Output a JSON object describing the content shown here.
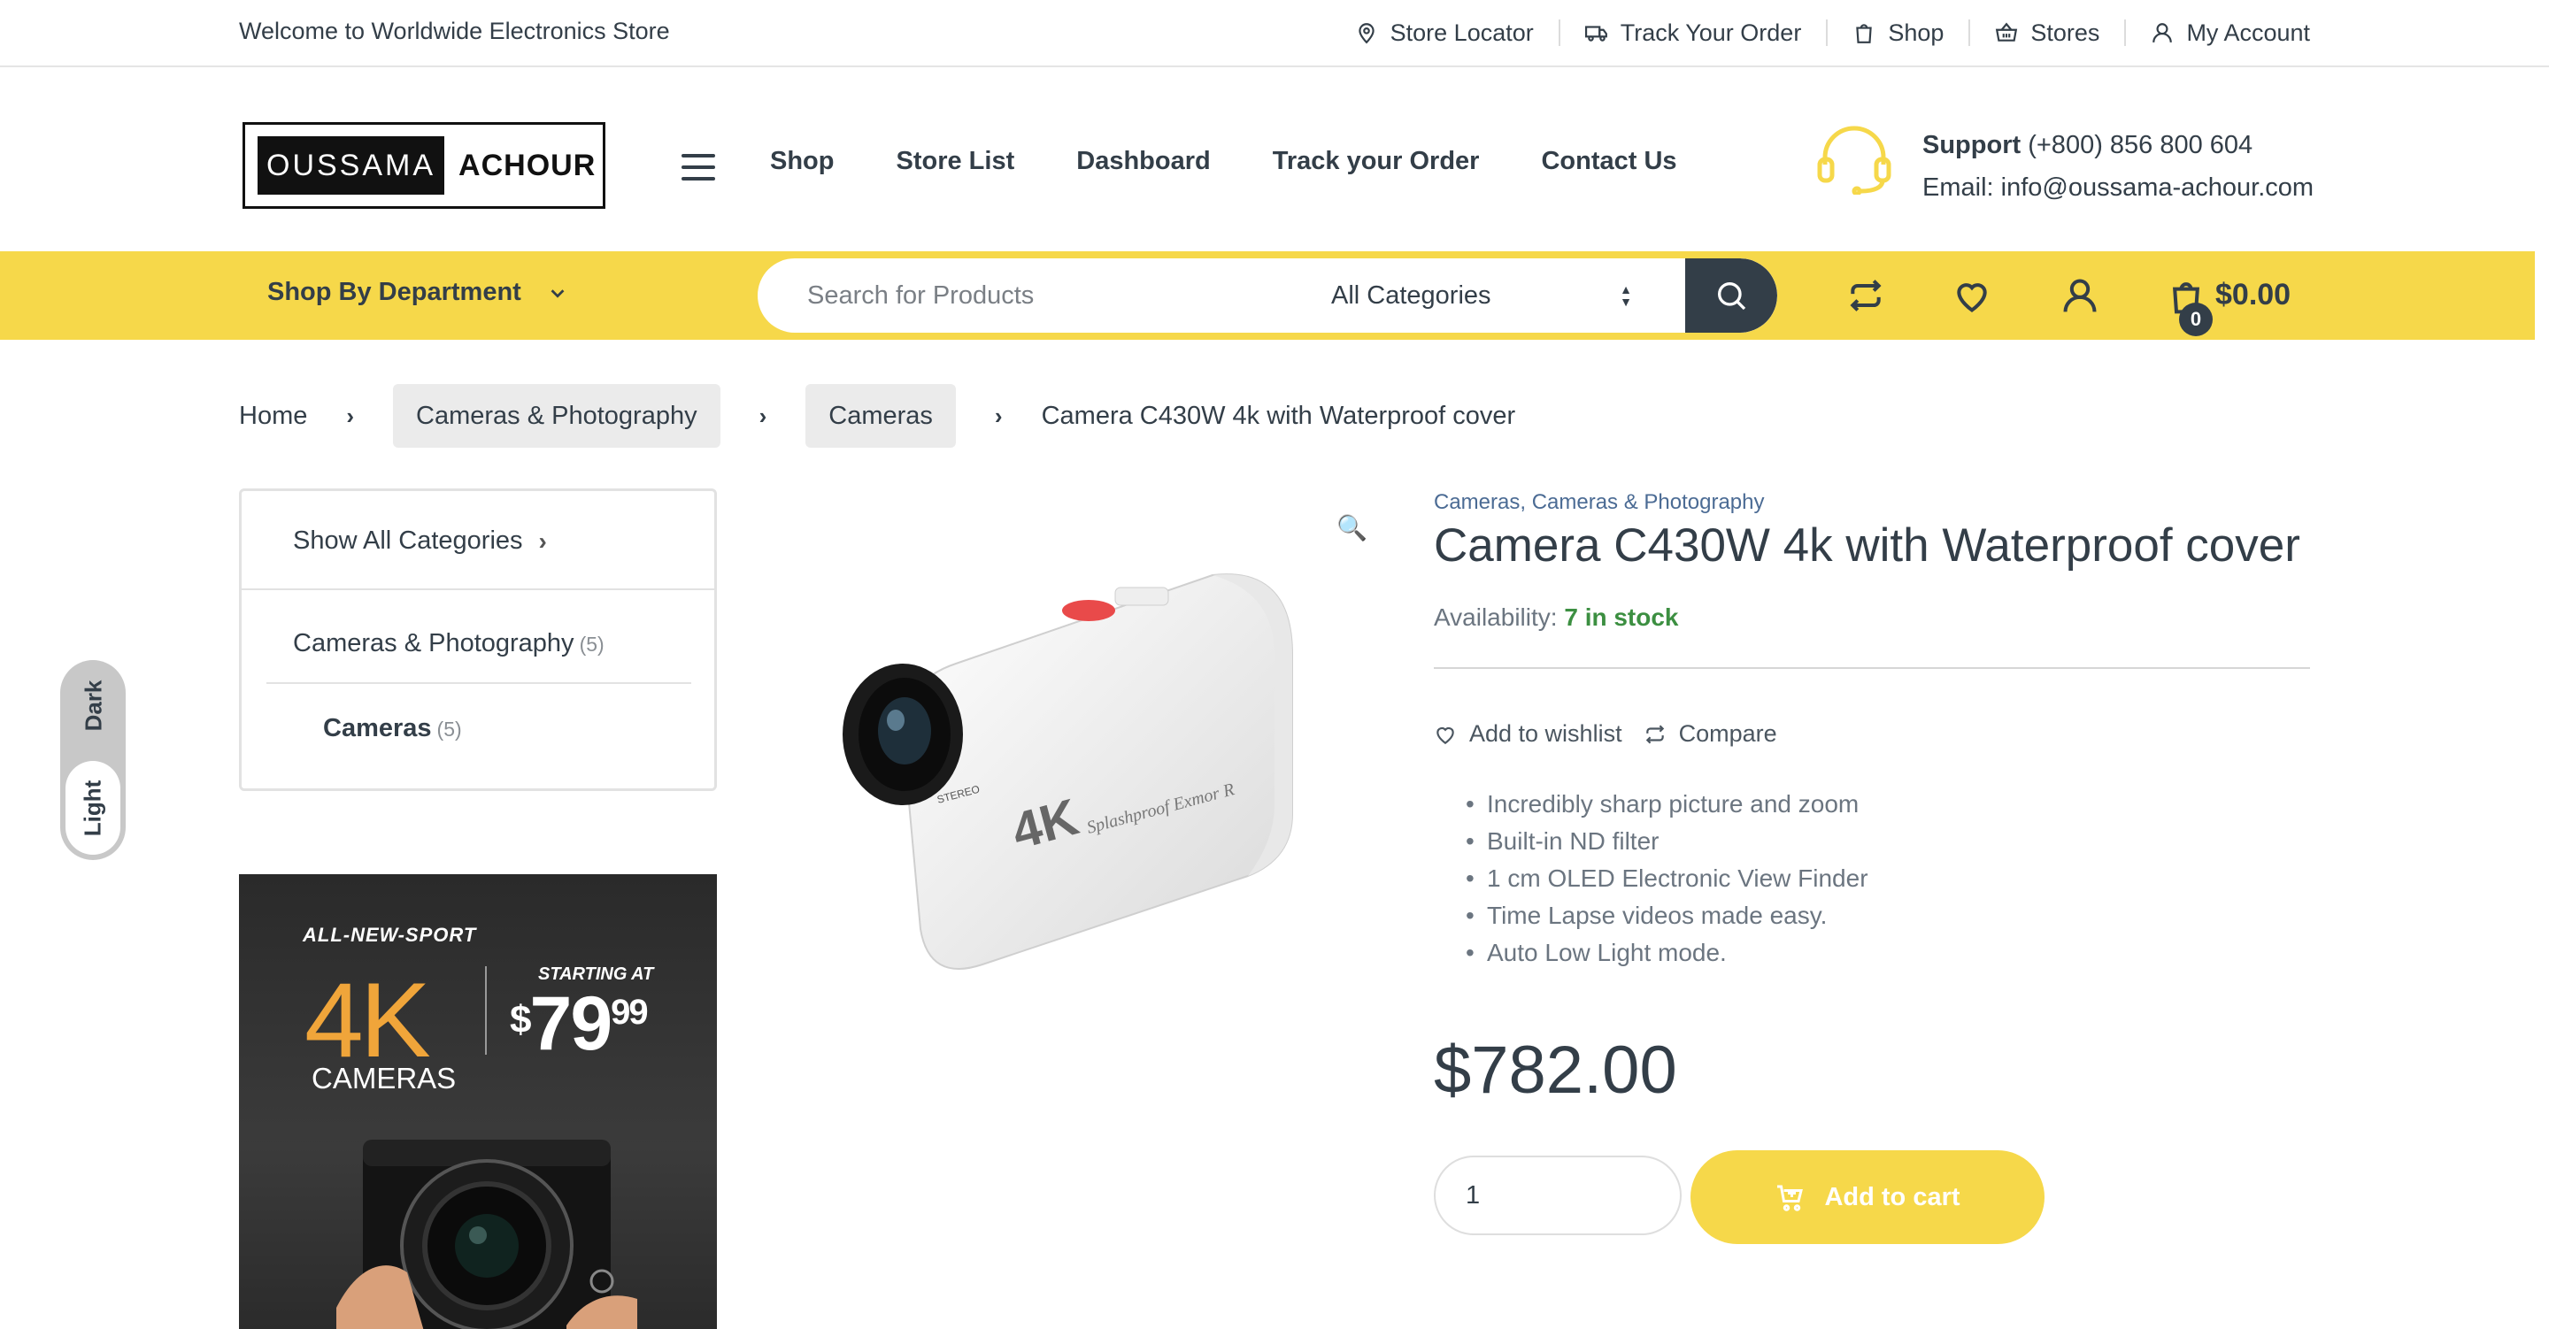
{
  "topbar": {
    "welcome": "Welcome to Worldwide Electronics Store",
    "links": [
      "Store Locator",
      "Track Your Order",
      "Shop",
      "Stores",
      "My Account"
    ]
  },
  "logo": {
    "part1": "OUSSAMA",
    "part2": "ACHOUR"
  },
  "nav": {
    "items": [
      "Shop",
      "Store List",
      "Dashboard",
      "Track your Order",
      "Contact Us"
    ]
  },
  "support": {
    "label": "Support",
    "phone": "(+800) 856 800 604",
    "email": "Email: info@oussama-achour.com"
  },
  "department": {
    "label": "Shop By Department"
  },
  "search": {
    "placeholder": "Search for Products",
    "category": "All Categories"
  },
  "cart": {
    "count": "0",
    "total": "$0.00"
  },
  "breadcrumb": [
    "Home",
    "Cameras & Photography",
    "Cameras",
    "Camera C430W 4k with Waterproof cover"
  ],
  "categories": {
    "show_all": "Show All Categories",
    "parent": {
      "name": "Cameras & Photography",
      "count": "(5)"
    },
    "child": {
      "name": "Cameras",
      "count": "(5)"
    }
  },
  "mode_toggle": {
    "dark": "Dark",
    "light": "Light"
  },
  "promo": {
    "headline": "ALL-NEW-SPORT",
    "big": "4K",
    "sub": "CAMERAS",
    "starting": "STARTING AT",
    "currency": "$",
    "price_whole": "79",
    "price_cents": "99"
  },
  "product": {
    "categories": [
      "Cameras",
      "Cameras & Photography"
    ],
    "categories_text": "Cameras, Cameras & Photography",
    "title": "Camera C430W 4k with Waterproof cover",
    "availability_label": "Availability:",
    "availability_value": "7 in stock",
    "wishlist": "Add to wishlist",
    "compare": "Compare",
    "features": [
      "Incredibly sharp picture and zoom",
      "Built-in ND filter",
      "1 cm OLED Electronic View Finder",
      "Time Lapse videos made easy.",
      "Auto Low Light mode."
    ],
    "price": "$782.00",
    "quantity": "1",
    "add_to_cart": "Add to cart",
    "image_text": {
      "brand": "4K",
      "model": "Splashproof  Exmor R",
      "stereo": "STEREO"
    }
  },
  "colors": {
    "accent": "#f6d84a",
    "dark": "#333e48",
    "in_stock": "#3c8f41",
    "link": "#4b6b94"
  },
  "icons": [
    "map-pin-icon",
    "truck-icon",
    "shopping-bag-icon",
    "basket-icon",
    "user-icon",
    "headset-icon",
    "chevron-down-icon",
    "search-icon",
    "compare-icon",
    "heart-icon",
    "cart-icon",
    "zoom-icon",
    "cart-plus-icon"
  ]
}
